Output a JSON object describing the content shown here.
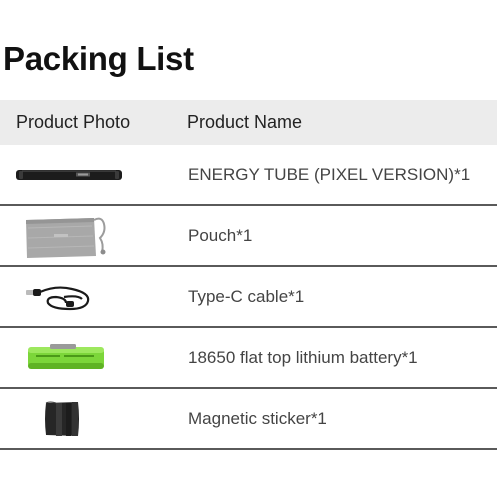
{
  "title": "Packing List",
  "table": {
    "headers": {
      "photo": "Product Photo",
      "name": "Product Name"
    },
    "rows": [
      {
        "name": "ENERGY TUBE (PIXEL VERSION)*1",
        "icon": "light-tube-icon"
      },
      {
        "name": "Pouch*1",
        "icon": "pouch-icon"
      },
      {
        "name": "Type-C cable*1",
        "icon": "usb-c-cable-icon"
      },
      {
        "name": "18650 flat top lithium battery*1",
        "icon": "battery-icon"
      },
      {
        "name": "Magnetic sticker*1",
        "icon": "magnetic-sticker-icon"
      }
    ]
  }
}
